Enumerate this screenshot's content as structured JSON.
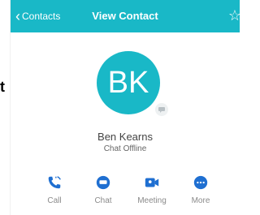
{
  "edge_text": "t",
  "header": {
    "back_label": "Contacts",
    "title": "View Contact"
  },
  "contact": {
    "initials": "BK",
    "name": "Ben Kearns",
    "status": "Chat Offline"
  },
  "actions": [
    {
      "label": "Call",
      "icon": "phone-icon"
    },
    {
      "label": "Chat",
      "icon": "chat-icon"
    },
    {
      "label": "Meeting",
      "icon": "video-icon"
    },
    {
      "label": "More",
      "icon": "more-icon"
    }
  ],
  "colors": {
    "accent": "#19b8c7",
    "action_icon": "#1f6fd1"
  }
}
